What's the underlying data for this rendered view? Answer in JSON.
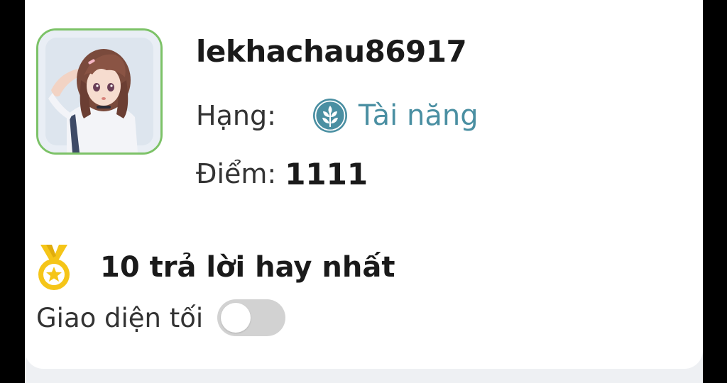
{
  "profile": {
    "username": "lekhachau86917",
    "rank_label": "Hạng:",
    "rank_name": "Tài năng",
    "points_label": "Điểm:",
    "points_value": "1111"
  },
  "achievements": {
    "best_answers_text": "10 trả lời hay nhất"
  },
  "settings": {
    "dark_mode_label": "Giao diện tối",
    "dark_mode_on": false
  },
  "icons": {
    "rank": "leaf-badge-icon",
    "medal": "gold-medal-icon"
  },
  "colors": {
    "avatar_border": "#7cc267",
    "rank_text": "#4a8fa2",
    "medal": "#f5c518",
    "toggle_off": "#d2d2d2"
  }
}
